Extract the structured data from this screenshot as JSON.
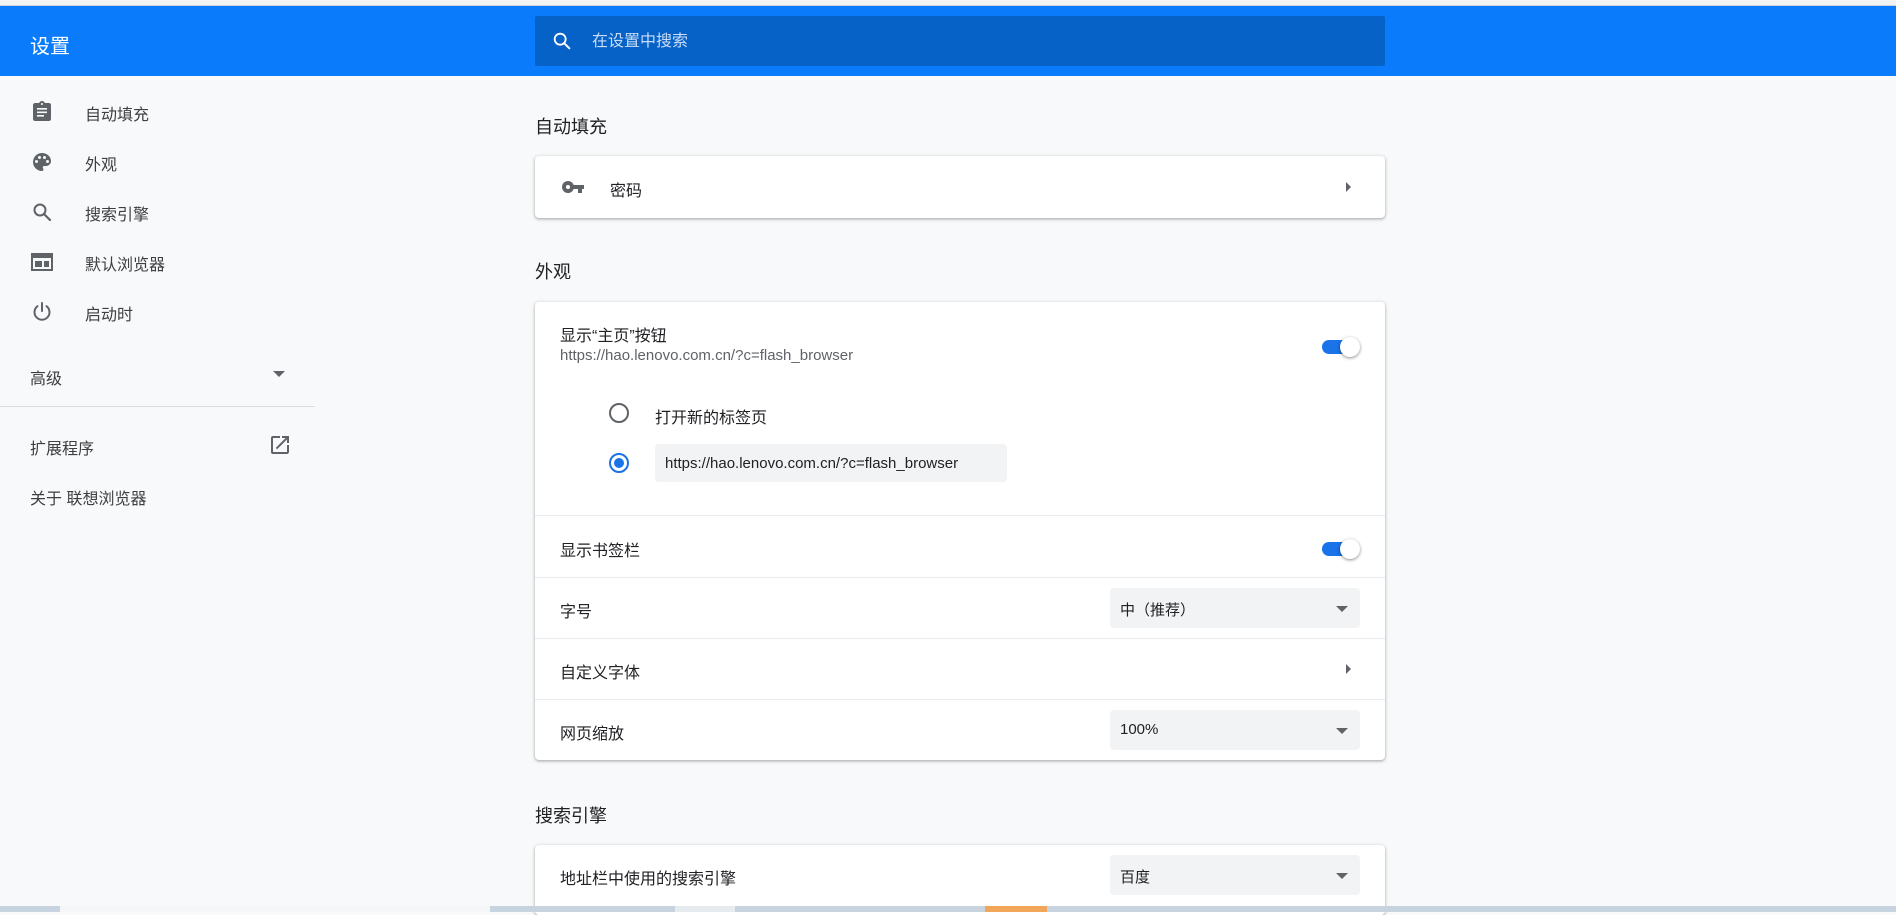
{
  "header": {
    "title": "设置",
    "search_placeholder": "在设置中搜索",
    "bg_color": "#0a7cfb"
  },
  "sidebar": {
    "items": [
      {
        "label": "自动填充",
        "icon": "clipboard-icon"
      },
      {
        "label": "外观",
        "icon": "palette-icon"
      },
      {
        "label": "搜索引擎",
        "icon": "search-icon"
      },
      {
        "label": "默认浏览器",
        "icon": "browser-window-icon"
      },
      {
        "label": "启动时",
        "icon": "power-icon"
      }
    ],
    "advanced_label": "高级",
    "extensions_label": "扩展程序",
    "about_label": "关于 联想浏览器"
  },
  "autofill": {
    "section_title": "自动填充",
    "passwords_label": "密码",
    "icon": "key-icon"
  },
  "appearance": {
    "section_title": "外观",
    "home_button_label": "显示“主页”按钮",
    "home_button_url": "https://hao.lenovo.com.cn/?c=flash_browser",
    "home_button_on": true,
    "radio_new_tab_label": "打开新的标签页",
    "radio_custom_url_value": "https://hao.lenovo.com.cn/?c=flash_browser",
    "selected_radio": "custom_url",
    "bookmarks_bar_label": "显示书签栏",
    "bookmarks_bar_on": true,
    "font_size_label": "字号",
    "font_size_value": "中（推荐）",
    "custom_fonts_label": "自定义字体",
    "page_zoom_label": "网页缩放",
    "page_zoom_value": "100%"
  },
  "search_engine": {
    "section_title": "搜索引擎",
    "address_bar_label": "地址栏中使用的搜索引擎",
    "address_bar_value": "百度"
  },
  "accent_color": "#1a73e8"
}
